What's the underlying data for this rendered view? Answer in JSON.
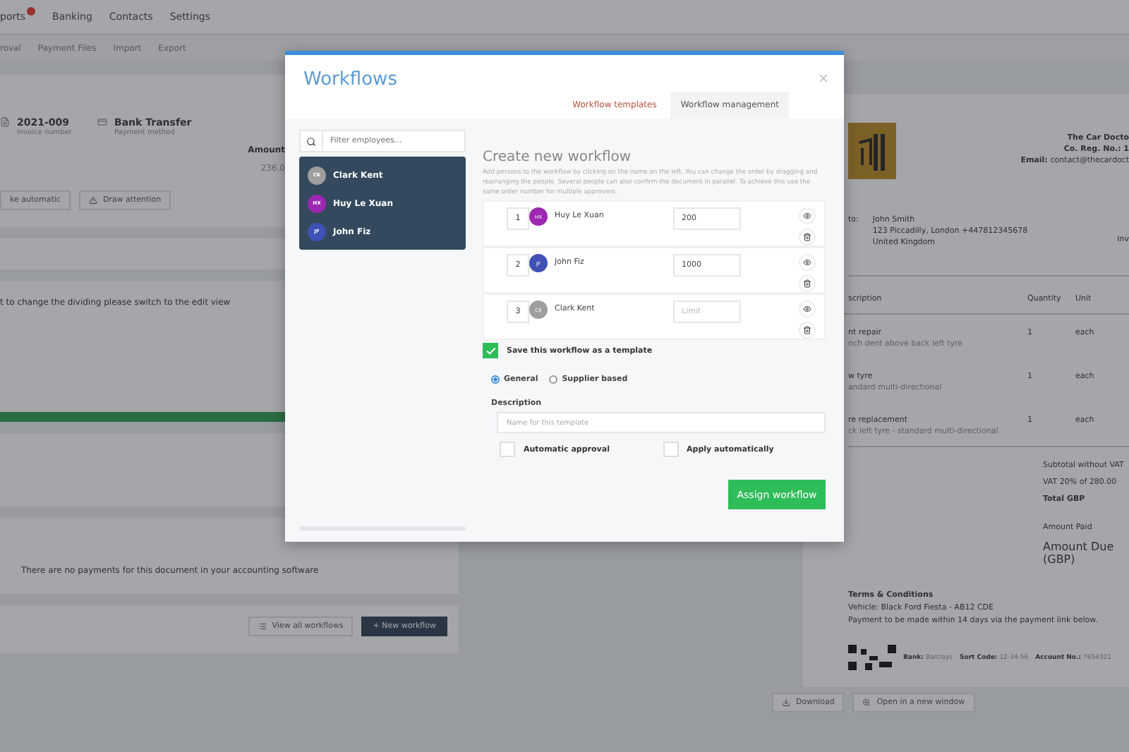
{
  "nav": {
    "items": [
      "ports",
      "Banking",
      "Contacts",
      "Settings"
    ]
  },
  "subnav": {
    "items": [
      "roval",
      "Payment Files",
      "Import",
      "Export"
    ]
  },
  "document_card": {
    "fields": [
      {
        "value": "2021-009",
        "label": "Invoice number"
      },
      {
        "value": "Bank Transfer",
        "label": "Payment method"
      }
    ],
    "amount_header": "Amount",
    "amount": "236.0",
    "buttons": [
      "ke automatic",
      "Draw attention"
    ]
  },
  "split_note": "t to change the dividing please switch to the edit view",
  "payments_note": "There are no payments for this document in your accounting software",
  "workflow_buttons": [
    "View all workflows",
    "+ New workflow"
  ],
  "invoice": {
    "company": [
      "The Car Docto",
      "Co. Reg. No.: 1"
    ],
    "email_label": "Email:",
    "email": "contact@thecardoct",
    "to_label": "to:",
    "address": [
      "John Smith",
      "123 Piccadilly, London +447812345678",
      "United Kingdom"
    ],
    "invoice_side": "Inv",
    "columns": [
      "scription",
      "Quantity",
      "Unit"
    ],
    "rows": [
      {
        "item": "nt repair",
        "detail": "nch dent above back left tyre",
        "quantity": "1",
        "unit": "each"
      },
      {
        "item": "w tyre",
        "detail": "andard multi-directional",
        "quantity": "1",
        "unit": "each"
      },
      {
        "item": "re replacement",
        "detail": "ck left tyre - standard multi-directional",
        "quantity": "1",
        "unit": "each"
      }
    ],
    "totals": [
      "Subtotal without VAT",
      "VAT 20% of 280.00",
      "Total GBP"
    ],
    "amount_paid": "Amount Paid",
    "amount_due": "Amount Due (GBP)",
    "terms_title": "Terms & Conditions",
    "terms": [
      "Vehicle: Black Ford Fiesta - AB12 CDE",
      "Payment to be made within 14 days via the payment link below."
    ],
    "bank": [
      {
        "label": "Bank:",
        "value": "Barclays"
      },
      {
        "label": "Sort Code:",
        "value": "12-34-56"
      },
      {
        "label": "Account No.:",
        "value": "7654321"
      }
    ],
    "actions": [
      "Download",
      "Open in a new window"
    ]
  },
  "modal": {
    "title": "Workflows",
    "tabs": [
      {
        "label": "Workflow templates",
        "selected": false
      },
      {
        "label": "Workflow management",
        "selected": true
      }
    ],
    "search": {
      "placeholder": "Filter employees..."
    },
    "employees": [
      {
        "initials": "CK",
        "name": "Clark Kent",
        "color": "#9e9e9e"
      },
      {
        "initials": "HX",
        "name": "Huy Le Xuan",
        "color": "#9c27b0"
      },
      {
        "initials": "JF",
        "name": "John Fiz",
        "color": "#3f51b5"
      }
    ],
    "create_title": "Create new workflow",
    "create_help": "Add persons to the workflow by clicking on the name on the left. You can change the order by dragging and rearranging the people. Several people can also confirm the document in parallel. To achieve this use the same order number for multiple approvers.",
    "approvers": [
      {
        "order": "1",
        "initials": "HX",
        "name": "Huy Le Xuan",
        "color": "#9c27b0",
        "limit": "200"
      },
      {
        "order": "2",
        "initials": "JF",
        "name": "John Fiz",
        "color": "#3f51b5",
        "limit": "1000"
      },
      {
        "order": "3",
        "initials": "CK",
        "name": "Clark Kent",
        "color": "#9e9e9e",
        "limit_placeholder": "Limit"
      }
    ],
    "save_template": {
      "label": "Save this workflow as a template",
      "checked": true
    },
    "types": [
      {
        "label": "General",
        "selected": true
      },
      {
        "label": "Supplier based",
        "selected": false
      }
    ],
    "description_label": "Description",
    "description_placeholder": "Name for this template",
    "options": [
      {
        "label": "Automatic approval",
        "checked": false
      },
      {
        "label": "Apply automatically",
        "checked": false
      }
    ],
    "submit": "Assign workflow"
  }
}
